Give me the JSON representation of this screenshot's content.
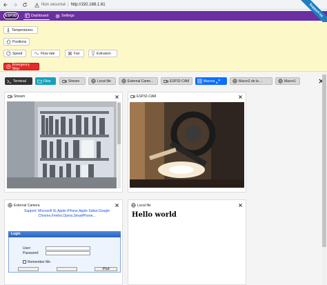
{
  "browser": {
    "security_label": "Non sécurisé",
    "separator": "|",
    "url": "http://192.168.1.61"
  },
  "app": {
    "logo": "ESP3D",
    "nav": [
      {
        "label": "Dashboard",
        "icon": "dashboard-icon",
        "active": true
      },
      {
        "label": "Settings",
        "icon": "gear-icon",
        "active": false
      }
    ],
    "ribbon": "Support us"
  },
  "controls": {
    "temperatures": "Temperatures",
    "positions": "Positions",
    "speed": "Speed",
    "flow_rate": "Flow rate",
    "fan": "Fan",
    "extrusion": "Extrusion",
    "emergency_stop": "Emergency Stop"
  },
  "tabs": [
    {
      "label": "Terminal",
      "icon": "terminal-icon",
      "style": "dark"
    },
    {
      "label": "Files",
      "icon": "folder-icon",
      "style": "cyan"
    },
    {
      "label": "Stream",
      "icon": "camera-icon",
      "style": "grey"
    },
    {
      "label": "Local file",
      "icon": "globe-icon",
      "style": "grey"
    },
    {
      "label": "External Came...",
      "icon": "globe-icon",
      "style": "grey"
    },
    {
      "label": "ESP32-CAM",
      "icon": "camera-icon",
      "style": "grey"
    },
    {
      "label": "Macros",
      "icon": "grid-icon",
      "style": "blue"
    },
    {
      "label": "Macro2 de la ...",
      "icon": "globe-icon",
      "style": "grey"
    },
    {
      "label": "Macro1",
      "icon": "globe-icon",
      "style": "grey"
    }
  ],
  "panels": {
    "stream": {
      "title": "Stream"
    },
    "esp32cam": {
      "title": "ESP32-CAM"
    },
    "external": {
      "title": "External Camera",
      "support_text": "Support: Microsoft IE,Apple iPhone,Apple Safari,Google Chrome,Firefox,Opera,SmartPhone...",
      "login_title": "Login",
      "user_label": "User:",
      "password_label": "Password:",
      "remember_label": "Remember Me",
      "ipad_label": "iPad"
    },
    "localfile": {
      "title": "Local file",
      "heading": "Hello world"
    }
  }
}
